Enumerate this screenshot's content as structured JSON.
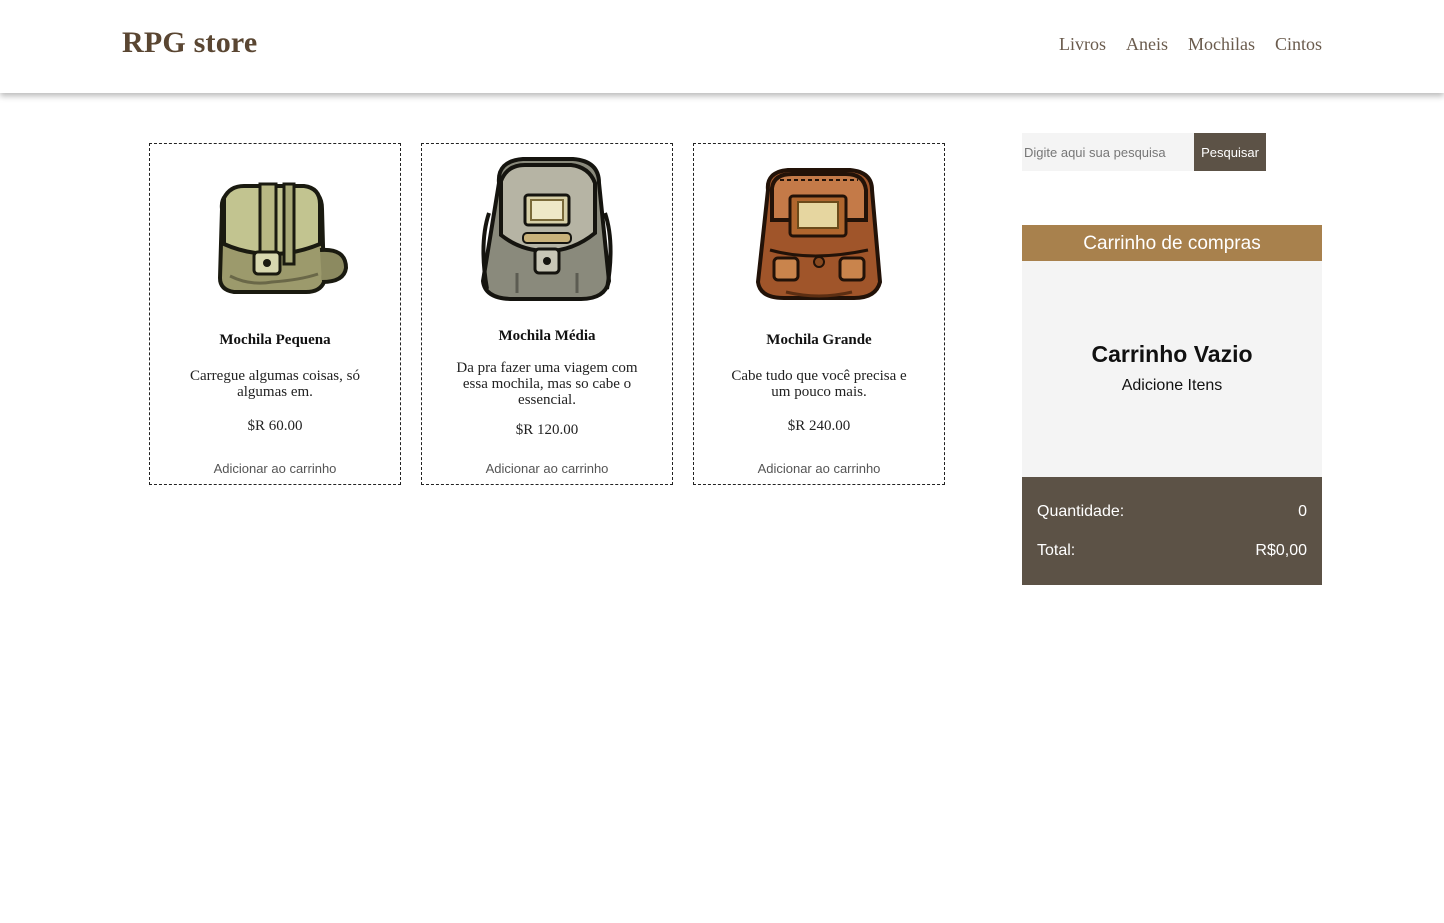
{
  "header": {
    "brand": "RPG store",
    "nav": [
      "Livros",
      "Aneis",
      "Mochilas",
      "Cintos"
    ]
  },
  "products": [
    {
      "name": "Mochila Pequena",
      "description": "Carregue algumas coisas, só algumas em.",
      "price": "$R 60.00",
      "add_label": "Adicionar ao carrinho",
      "image_icon": "small-green-satchel-icon"
    },
    {
      "name": "Mochila Média",
      "description": "Da pra fazer uma viagem com essa mochila, mas so cabe o essencial.",
      "price": "$R 120.00",
      "add_label": "Adicionar ao carrinho",
      "image_icon": "grey-backpack-icon"
    },
    {
      "name": "Mochila Grande",
      "description": "Cabe tudo que você precisa e um pouco mais.",
      "price": "$R 240.00",
      "add_label": "Adicionar ao carrinho",
      "image_icon": "brown-large-backpack-icon"
    }
  ],
  "search": {
    "placeholder": "Digite aqui sua pesquisa",
    "button_label": "Pesquisar"
  },
  "cart": {
    "title": "Carrinho de compras",
    "empty_title": "Carrinho Vazio",
    "empty_subtitle": "Adicione Itens",
    "quantity_label": "Quantidade:",
    "quantity_value": "0",
    "total_label": "Total:",
    "total_value": "R$0,00"
  },
  "colors": {
    "brand": "#5a4632",
    "cart_header": "#a8814d",
    "dark_panel": "#5c5246",
    "light_panel": "#f4f4f4"
  }
}
